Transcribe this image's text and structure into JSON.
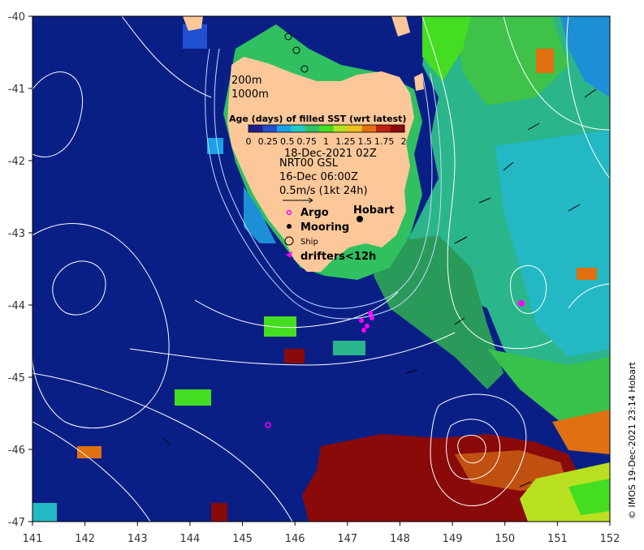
{
  "axes": {
    "x_ticks": [
      "141",
      "142",
      "143",
      "144",
      "145",
      "146",
      "147",
      "148",
      "149",
      "150",
      "151",
      "152"
    ],
    "y_ticks": [
      "-40",
      "-41",
      "-42",
      "-43",
      "-44",
      "-45",
      "-46",
      "-47"
    ]
  },
  "depth_labels": [
    "200m",
    "1000m"
  ],
  "legend": {
    "title": "Age (days) of filled SST (wrt latest)",
    "ticks": [
      "0",
      "0.25",
      "0.5",
      "0.75",
      "1",
      "1.25",
      "1.5",
      "1.75",
      "2"
    ],
    "colors": [
      "#1e1e8c",
      "#2050d0",
      "#1aa0e6",
      "#20c8c8",
      "#30c060",
      "#44dd22",
      "#b8e020",
      "#f0c020",
      "#e07010",
      "#c02010",
      "#8a0a0a"
    ]
  },
  "info": {
    "sst_date": "18-Dec-2021 02Z",
    "altimetry": "NRT00 GSL",
    "altimetry_date": "16-Dec 06:00Z",
    "vector_scale": "0.5m/s (1kt 24h)"
  },
  "key": {
    "argo": "Argo",
    "mooring": "Mooring",
    "ship": "Ship",
    "drifters": "drifters<12h"
  },
  "place_labels": {
    "hobart": "Hobart"
  },
  "credit": "© IMOS 19-Dec-2021 23:14 Hobart",
  "colors": {
    "ocean": "#0a1f86",
    "land": "#fcc89a",
    "contour": "#ffffff",
    "argo": "#ff00ff",
    "drifter": "#ff00ff"
  }
}
